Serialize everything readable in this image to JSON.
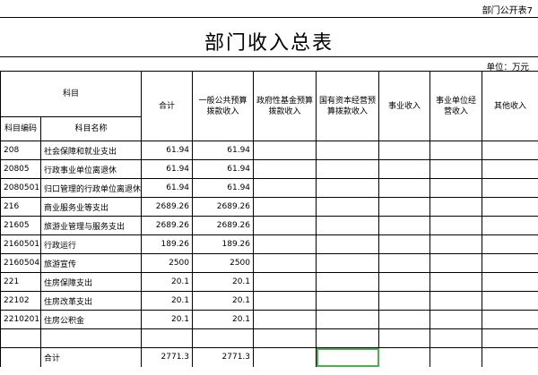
{
  "corner_label": "部门公开表7",
  "title": "部门收入总表",
  "unit": "单位：万元",
  "headers": {
    "subject_group": "科目",
    "total": "合计",
    "gen_budget": "一般公共预算拨款收入",
    "fund_budget": "政府性基金预算拨款收入",
    "state_capital": "国有资本经营预算拨款收入",
    "business_income": "事业收入",
    "unit_operating": "事业单位经营收入",
    "other_income": "其他收入",
    "code": "科目编码",
    "name": "科目名称"
  },
  "rows": [
    {
      "code": "208",
      "name": "社会保障和就业支出",
      "total": "61.94",
      "gen": "61.94"
    },
    {
      "code": "20805",
      "name": "行政事业单位离退休",
      "total": "61.94",
      "gen": "61.94"
    },
    {
      "code": "2080501",
      "name": "归口管理的行政单位离退休",
      "total": "61.94",
      "gen": "61.94"
    },
    {
      "code": "216",
      "name": "商业服务业等支出",
      "total": "2689.26",
      "gen": "2689.26"
    },
    {
      "code": "21605",
      "name": "旅游业管理与服务支出",
      "total": "2689.26",
      "gen": "2689.26"
    },
    {
      "code": "2160501",
      "name": "行政运行",
      "total": "189.26",
      "gen": "189.26"
    },
    {
      "code": "2160504",
      "name": "旅游宣传",
      "total": "2500",
      "gen": "2500"
    },
    {
      "code": "221",
      "name": "住房保障支出",
      "total": "20.1",
      "gen": "20.1"
    },
    {
      "code": "22102",
      "name": "住房改革支出",
      "total": "20.1",
      "gen": "20.1"
    },
    {
      "code": "2210201",
      "name": "住房公积金",
      "total": "20.1",
      "gen": "20.1"
    },
    {
      "code": "",
      "name": "",
      "total": "",
      "gen": ""
    }
  ],
  "total_row": {
    "label": "合计",
    "total": "2771.3",
    "gen": "2771.3"
  }
}
